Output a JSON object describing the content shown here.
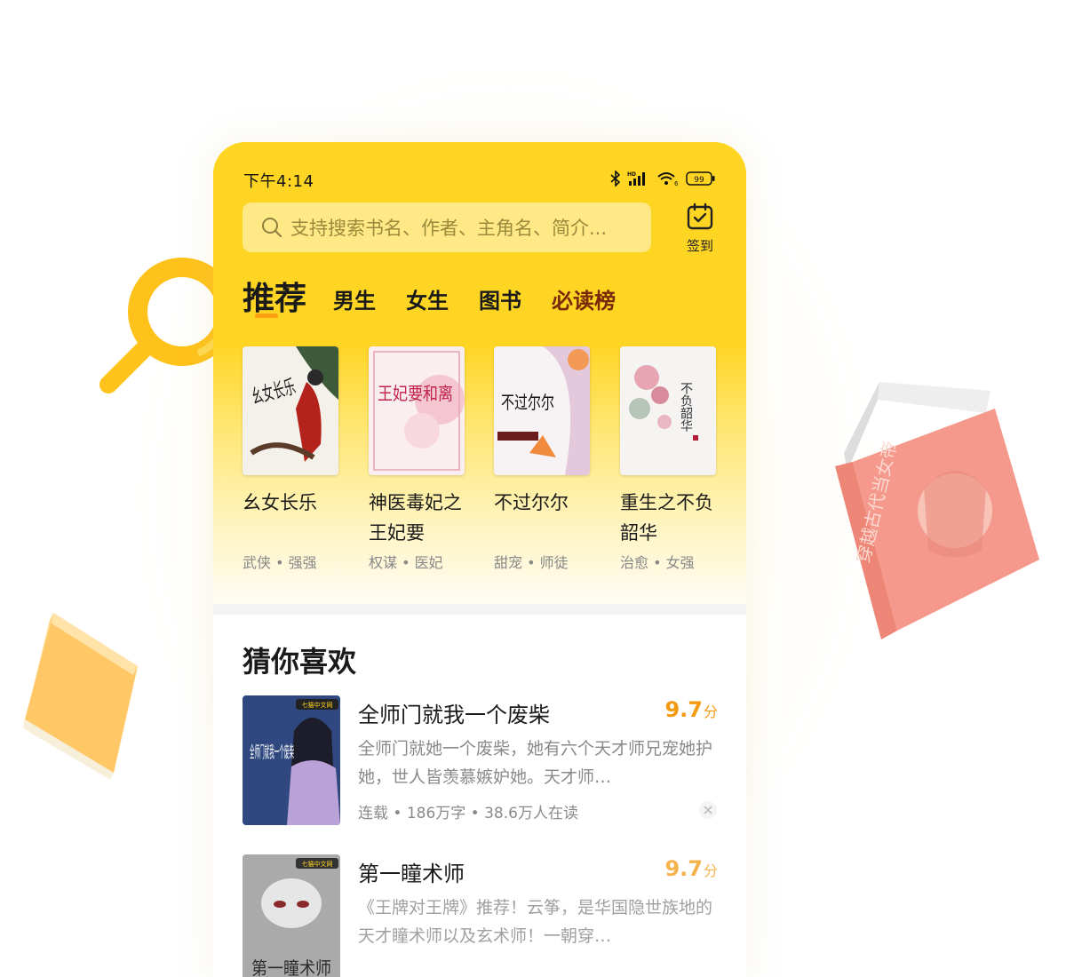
{
  "status_bar": {
    "time": "下午4:14",
    "battery": "99",
    "hd_label": "HD",
    "wifi_sub": "6"
  },
  "search": {
    "placeholder": "支持搜索书名、作者、主角名、简介...",
    "checkin_label": "签到"
  },
  "tabs": [
    {
      "label": "推荐",
      "active": true
    },
    {
      "label": "男生"
    },
    {
      "label": "女生"
    },
    {
      "label": "图书"
    },
    {
      "label": "必读榜"
    }
  ],
  "featured_books": [
    {
      "title": "幺女长乐",
      "tags": "武侠 • 强强",
      "cover_text": "幺女长乐"
    },
    {
      "title": "神医毒妃之王妃要",
      "tags": "权谋 • 医妃",
      "cover_text": "王妃要和离"
    },
    {
      "title": "不过尔尔",
      "tags": "甜宠 • 师徒",
      "cover_text": "不过尔尔"
    },
    {
      "title": "重生之不负韶华",
      "tags": "治愈 • 女强",
      "cover_text": "不负韶华"
    }
  ],
  "guess_section": {
    "title": "猜你喜欢",
    "items": [
      {
        "title": "全师门就我一个废柴",
        "score": "9.7",
        "score_unit": "分",
        "description": "全师门就她一个废柴，她有六个天才师兄宠她护她，世人皆羡慕嫉妒她。天才师…",
        "meta": "连载 • 186万字 • 38.6万人在读",
        "cover_badge": "七猫中文网",
        "cover_text": "全师门就我一个废柴"
      },
      {
        "title": "第一瞳术师",
        "score": "9.7",
        "score_unit": "分",
        "description": "《王牌对王牌》推荐！云筝，是华国隐世族地的天才瞳术师以及玄术师！一朝穿…",
        "cover_badge": "七猫中文网",
        "cover_text": "第一瞳术师"
      }
    ]
  },
  "pink_book_spine": "穿越古代当女帝",
  "colors": {
    "brand_yellow": "#FFD523",
    "score_orange": "#F39A12",
    "tab_underline": "#FF9F12"
  }
}
